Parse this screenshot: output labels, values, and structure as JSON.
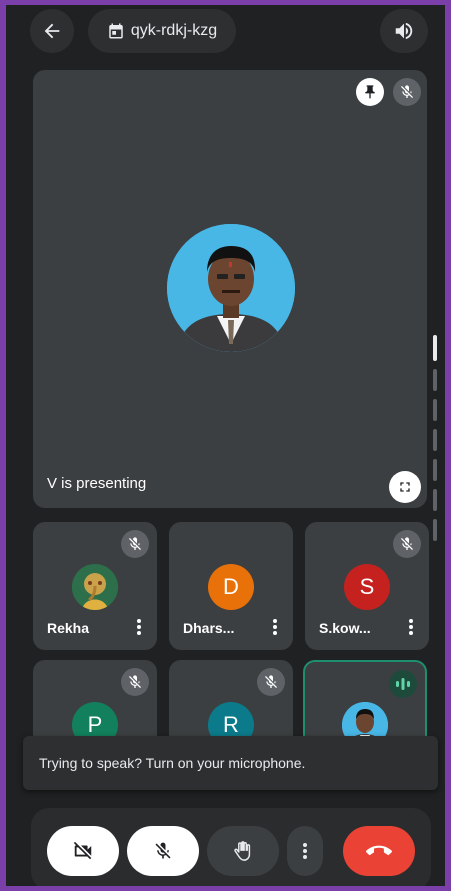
{
  "meeting": {
    "code": "qyk-rdkj-kzg"
  },
  "presenter": {
    "status_text": "V is presenting"
  },
  "participants": [
    {
      "name": "Rekha",
      "avatar_letter": "",
      "avatar_color": "#2c6f4a",
      "muted": true
    },
    {
      "name": "Dhars...",
      "avatar_letter": "D",
      "avatar_color": "#e8710a",
      "muted": false
    },
    {
      "name": "S.kow...",
      "avatar_letter": "S",
      "avatar_color": "#c5221f",
      "muted": true
    },
    {
      "name": "",
      "avatar_letter": "P",
      "avatar_color": "#12805c",
      "muted": true
    },
    {
      "name": "",
      "avatar_letter": "R",
      "avatar_color": "#0b7a8a",
      "muted": true
    },
    {
      "name": "",
      "avatar_letter": "",
      "avatar_color": "#48b7e6",
      "muted": false,
      "speaking": true
    }
  ],
  "toast": {
    "message": "Trying to speak? Turn on your microphone."
  },
  "colors": {
    "background": "#1f2123",
    "tile": "#3c3f41",
    "end_call": "#ea4335",
    "speaking_border": "#1e8e6e",
    "frame_border": "#7a3fa8"
  },
  "icons": {
    "back": "arrow-left-icon",
    "calendar": "calendar-icon",
    "speaker": "speaker-icon",
    "pin": "pin-icon",
    "mic_off": "mic-off-icon",
    "fullscreen": "fullscreen-icon",
    "camera_off": "camera-off-icon",
    "hand": "raise-hand-icon",
    "more": "more-vert-icon",
    "end_call": "end-call-icon"
  }
}
